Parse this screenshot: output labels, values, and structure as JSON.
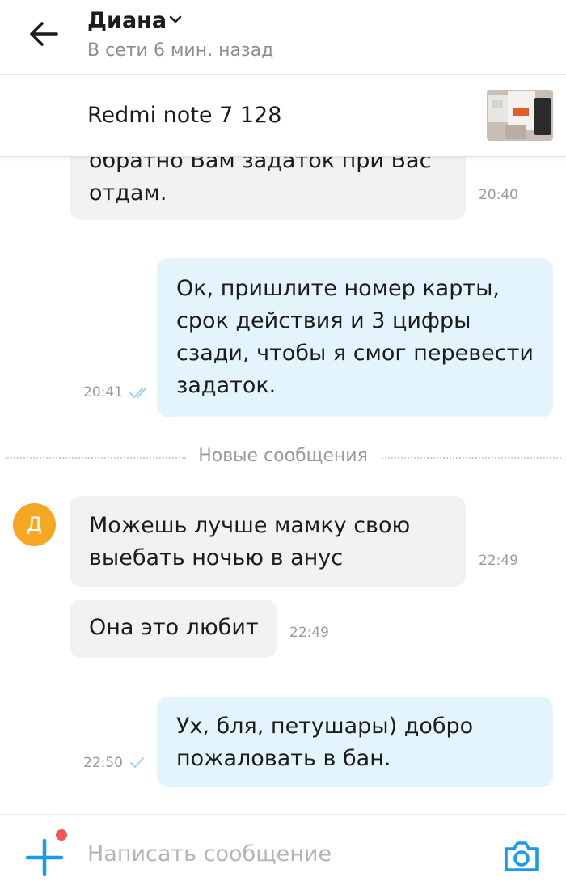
{
  "header": {
    "contact_name": "Диана",
    "status": "В сети 6 мин. назад"
  },
  "product": {
    "title": "Redmi note 7 128"
  },
  "messages": [
    {
      "direction": "in",
      "text": "обратно Вам задаток при Вас\nотдам.",
      "time": "20:40"
    },
    {
      "direction": "out",
      "text": "Ок, пришлите номер карты,\nсрок действия и 3 цифры\nсзади, чтобы я смог перевести\nзадаток.",
      "time": "20:41",
      "status": "read"
    },
    {
      "direction": "in",
      "text": "Можешь лучше мамку свою\nвыебать ночью в анус",
      "time": "22:49"
    },
    {
      "direction": "in",
      "text": "Она это любит",
      "time": "22:49"
    },
    {
      "direction": "out",
      "text": "Ух, бля, петушары) добро\nпожаловать в бан.",
      "time": "22:50",
      "status": "sent"
    }
  ],
  "divider": {
    "label": "Новые сообщения"
  },
  "avatar": {
    "letter": "Д",
    "color": "#f5a623"
  },
  "composer": {
    "placeholder": "Написать сообщение"
  },
  "icons": {
    "back": "arrow-left-icon",
    "chevron": "chevron-down-icon",
    "read_status": "double-check-icon",
    "sent_status": "check-icon",
    "attach": "plus-icon",
    "camera": "camera-icon"
  },
  "colors": {
    "accent": "#1a9be6",
    "outgoing_bubble": "#e4f4fd",
    "incoming_bubble": "#f2f2f2",
    "notification_dot": "#ee5a5a"
  }
}
